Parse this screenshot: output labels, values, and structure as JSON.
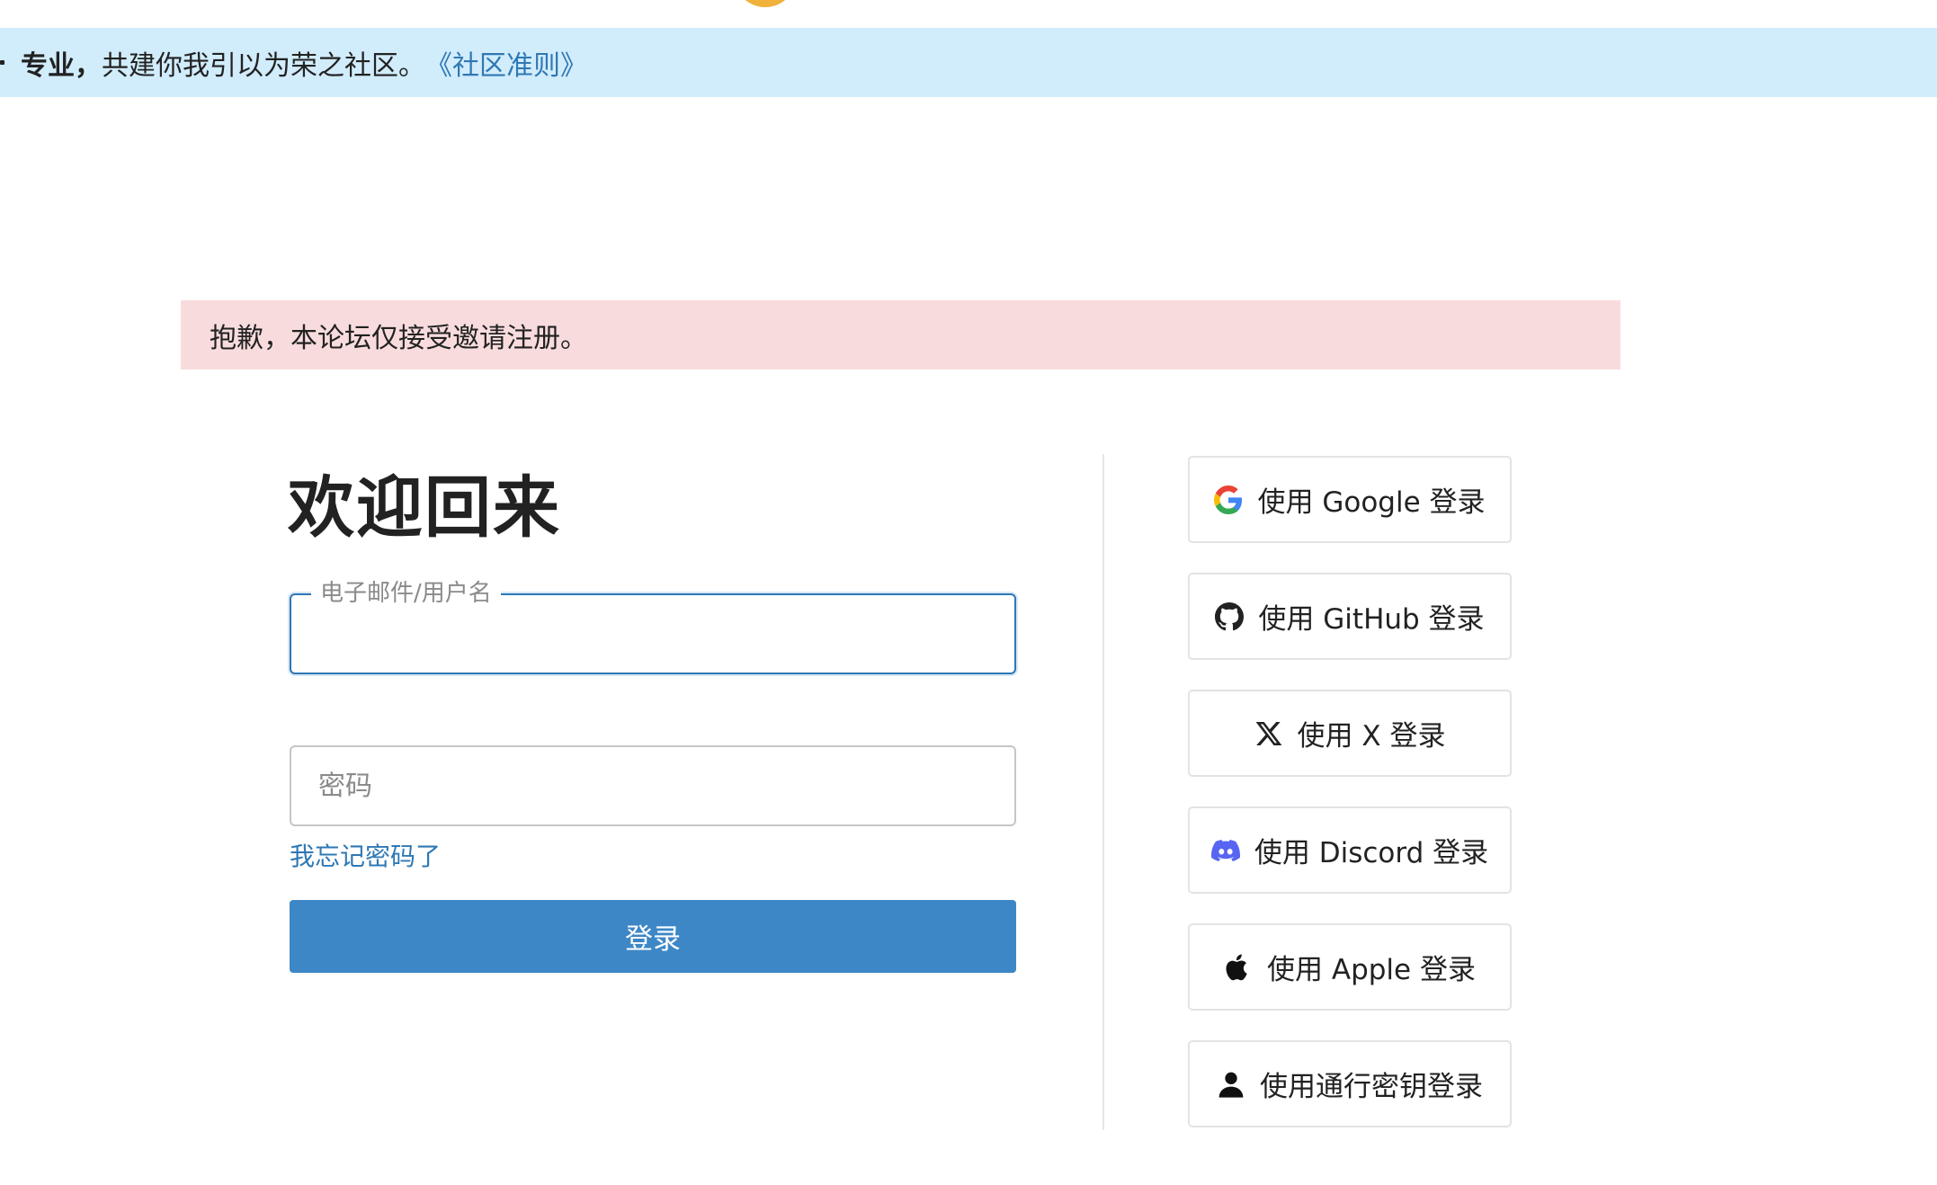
{
  "banner": {
    "bold_text": "专业，",
    "text": "共建你我引以为荣之社区。",
    "link": "《社区准则》"
  },
  "alert": {
    "text": "抱歉，本论坛仅接受邀请注册。"
  },
  "login": {
    "title": "欢迎回来",
    "email_label": "电子邮件/用户名",
    "email_value": "",
    "password_placeholder": "密码",
    "forgot_link": "我忘记密码了",
    "submit_label": "登录"
  },
  "social": [
    {
      "label": "使用 Google 登录",
      "icon": "google-icon"
    },
    {
      "label": "使用 GitHub 登录",
      "icon": "github-icon"
    },
    {
      "label": "使用 X 登录",
      "icon": "x-icon"
    },
    {
      "label": "使用 Discord 登录",
      "icon": "discord-icon"
    },
    {
      "label": "使用 Apple 登录",
      "icon": "apple-icon"
    },
    {
      "label": "使用通行密钥登录",
      "icon": "user-icon"
    }
  ],
  "colors": {
    "banner_bg": "#d1ecfb",
    "alert_bg": "#f8dcdd",
    "primary": "#3d87c6",
    "link": "#2f78b4"
  }
}
